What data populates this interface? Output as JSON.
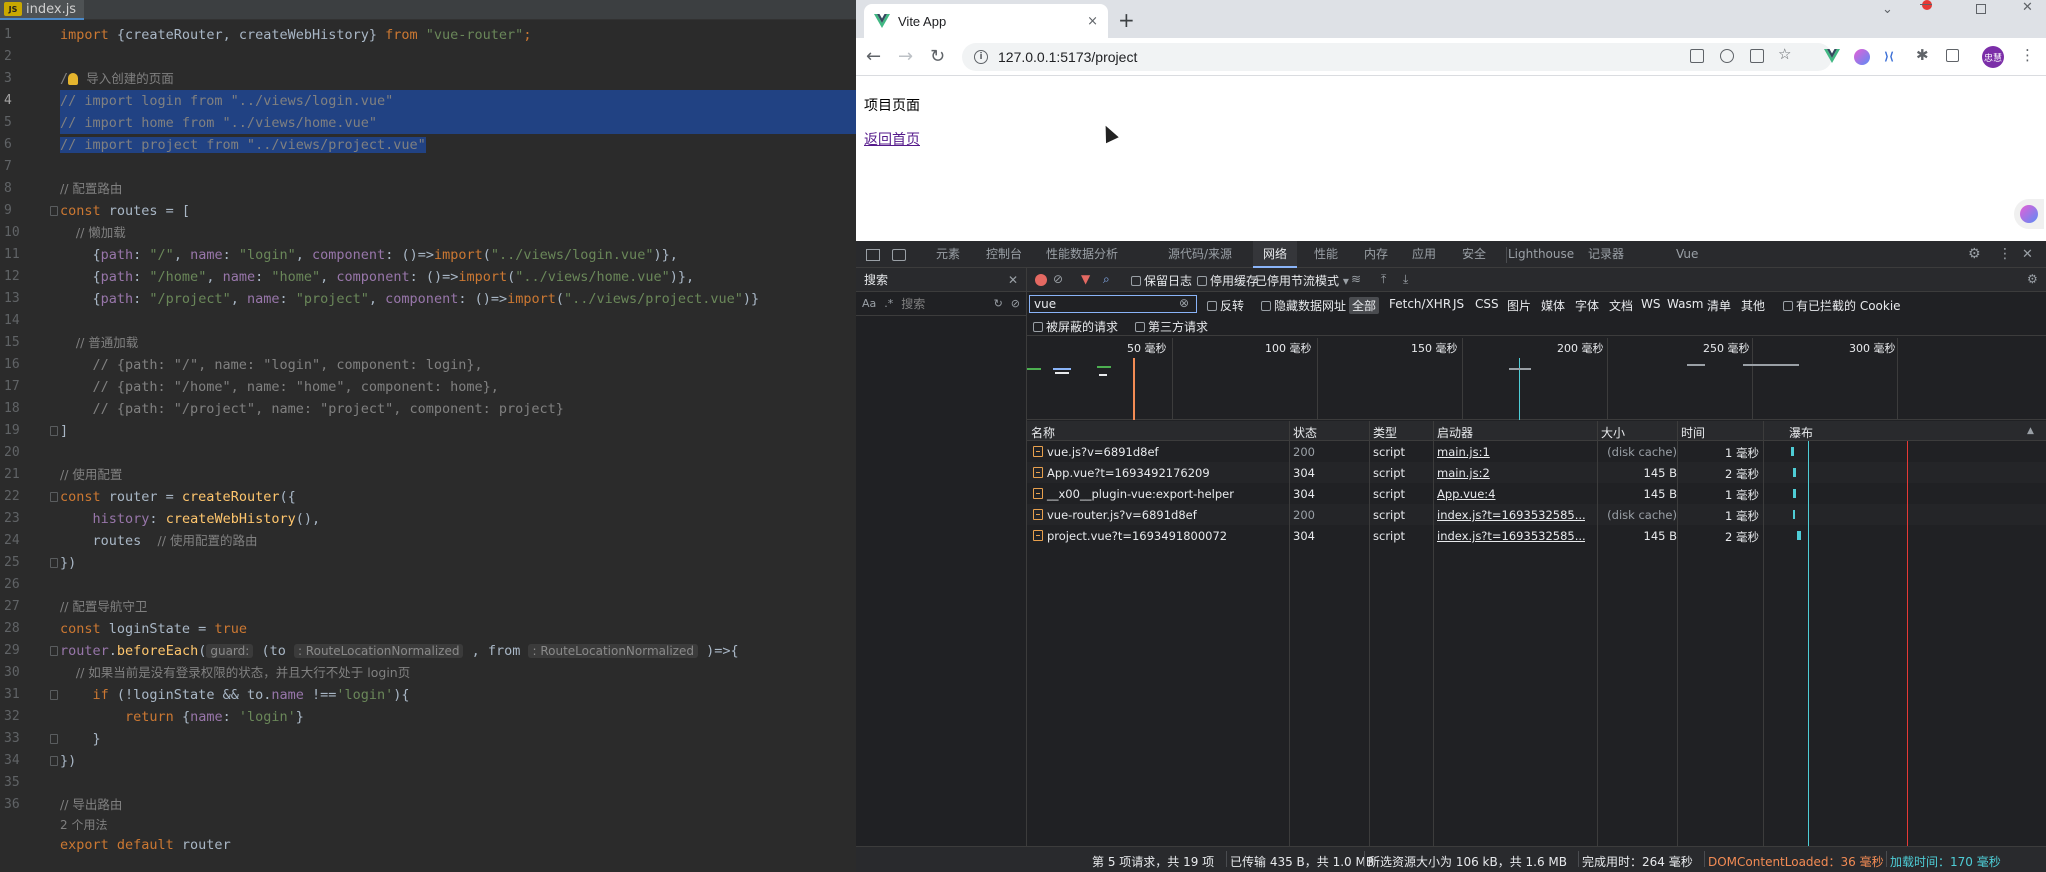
{
  "editor": {
    "file_tab": "index.js",
    "file_badge": "JS",
    "line_numbers": [
      "1",
      "2",
      "3",
      "4",
      "5",
      "6",
      "7",
      "8",
      "9",
      "10",
      "11",
      "12",
      "13",
      "14",
      "15",
      "16",
      "17",
      "18",
      "19",
      "20",
      "21",
      "22",
      "23",
      "24",
      "25",
      "26",
      "27",
      "28",
      "29",
      "30",
      "31",
      "32",
      "33",
      "34",
      "35",
      "36",
      ""
    ],
    "l1": {
      "a": "import",
      "b": " {createRouter, createWebHistory} ",
      "c": "from",
      "d": " \"vue-router\"",
      "e": ";"
    },
    "l3": {
      "a": "/",
      "b": "导入创建的页面"
    },
    "l4": "// import login from \"../views/login.vue\"",
    "l5": "// import home from \"../views/home.vue\"",
    "l6": "// import project from \"../views/project.vue\"",
    "l8": "// 配置路由",
    "l9": {
      "a": "const",
      "b": " routes = ["
    },
    "l10": "    // 懒加载",
    "l11": {
      "a": "    {",
      "b": "path",
      "c": ": ",
      "d": "\"/\"",
      "e": ", ",
      "f": "name",
      "g": ": ",
      "h": "\"login\"",
      "i": ", ",
      "j": "component",
      "k": ": ()=>",
      "l": "import",
      "m": "(",
      "n": "\"../views/login.vue\"",
      "o": ")},"
    },
    "l12": {
      "a": "    {",
      "b": "path",
      "c": ": ",
      "d": "\"/home\"",
      "e": ", ",
      "f": "name",
      "g": ": ",
      "h": "\"home\"",
      "i": ", ",
      "j": "component",
      "k": ": ()=>",
      "l": "import",
      "m": "(",
      "n": "\"../views/home.vue\"",
      "o": ")},"
    },
    "l13": {
      "a": "    {",
      "b": "path",
      "c": ": ",
      "d": "\"/project\"",
      "e": ", ",
      "f": "name",
      "g": ": ",
      "h": "\"project\"",
      "i": ", ",
      "j": "component",
      "k": ": ()=>",
      "l": "import",
      "m": "(",
      "n": "\"../views/project.vue\"",
      "o": ")}"
    },
    "l15": "    // 普通加载",
    "l16": "    // {path: \"/\", name: \"login\", component: login},",
    "l17": "    // {path: \"/home\", name: \"home\", component: home},",
    "l18": "    // {path: \"/project\", name: \"project\", component: project}",
    "l19": "]",
    "l21": "// 使用配置",
    "l22": {
      "a": "const",
      "b": " router = ",
      "c": "createRouter",
      "d": "({"
    },
    "l23": {
      "a": "    ",
      "b": "history",
      "c": ": ",
      "d": "createWebHistory",
      "e": "(),"
    },
    "l24": {
      "a": "    routes  ",
      "b": "// 使用配置的路由"
    },
    "l25": "})",
    "l27": "// 配置导航守卫",
    "l28": {
      "a": "const",
      "b": " loginState = ",
      "c": "true"
    },
    "l29": {
      "a": "router",
      "b": ".",
      "c": "beforeEach",
      "d": "(",
      "e": "guard:",
      "f": " (to ",
      "g": ": RouteLocationNormalized",
      "h": " , from ",
      "i": ": RouteLocationNormalized",
      "j": " )=>{"
    },
    "l30": "    // 如果当前是没有登录权限的状态，并且大行不处于 login页",
    "l31": {
      "a": "    ",
      "b": "if",
      "c": " (!loginState && to.",
      "d": "name",
      "e": " !==",
      "f": "'login'",
      "g": "){"
    },
    "l32": {
      "a": "        ",
      "b": "return",
      "c": " {",
      "d": "name",
      "e": ": ",
      "f": "'login'",
      "g": "}"
    },
    "l33": "    }",
    "l34": "})",
    "l36": "// 导出路由",
    "usages": "2 个用法",
    "l37": {
      "a": "export default",
      "b": " router"
    }
  },
  "browser": {
    "tab_title": "Vite App",
    "tab_close": "×",
    "new_tab": "+",
    "url": "127.0.0.1:5173/project",
    "avatar": "忠慧",
    "page_heading": "项目页面",
    "back_link": "返回首页"
  },
  "devtools": {
    "tabs": [
      "元素",
      "控制台",
      "性能数据分析",
      "源代码/来源",
      "网络",
      "性能",
      "内存",
      "应用",
      "安全",
      "Lighthouse",
      "记录器",
      "Vue"
    ],
    "active_tab": "网络",
    "search_label": "搜索",
    "search_aa": "Aa",
    "search_regex": ".*",
    "search_placeholder": "搜索",
    "toolbar": {
      "preserve_log": "保留日志",
      "disable_cache": "停用缓存",
      "throttle": "已停用节流模式"
    },
    "filter_value": "vue",
    "filters": {
      "invert": "反转",
      "hide_data_urls": "隐藏数据网址",
      "types": [
        "全部",
        "Fetch/XHR",
        "JS",
        "CSS",
        "图片",
        "媒体",
        "字体",
        "文档",
        "WS",
        "Wasm",
        "清单",
        "其他"
      ],
      "blocked_cookies": "有已拦截的 Cookie",
      "blocked_requests": "被屏蔽的请求",
      "third_party": "第三方请求"
    },
    "ticks": [
      "50 毫秒",
      "100 毫秒",
      "150 毫秒",
      "200 毫秒",
      "250 毫秒",
      "300 毫秒"
    ],
    "columns": {
      "name": "名称",
      "status": "状态",
      "type": "类型",
      "initiator": "启动器",
      "size": "大小",
      "time": "时间",
      "waterfall": "瀑布"
    },
    "rows": [
      {
        "name": "vue.js?v=6891d8ef",
        "status": "200",
        "type": "script",
        "initiator": "main.js:1",
        "size": "(disk cache)",
        "time": "1 毫秒"
      },
      {
        "name": "App.vue?t=1693492176209",
        "status": "304",
        "type": "script",
        "initiator": "main.js:2",
        "size": "145 B",
        "time": "2 毫秒"
      },
      {
        "name": "__x00__plugin-vue:export-helper",
        "status": "304",
        "type": "script",
        "initiator": "App.vue:4",
        "size": "145 B",
        "time": "1 毫秒"
      },
      {
        "name": "vue-router.js?v=6891d8ef",
        "status": "200",
        "type": "script",
        "initiator": "index.js?t=1693532585...",
        "size": "(disk cache)",
        "time": "1 毫秒"
      },
      {
        "name": "project.vue?t=1693491800072",
        "status": "304",
        "type": "script",
        "initiator": "index.js?t=1693532585...",
        "size": "145 B",
        "time": "2 毫秒"
      }
    ],
    "status": {
      "requests": "第 5 项请求，共 19 项",
      "transferred": "已传输 435 B，共 1.0 MB",
      "resources": "所选资源大小为 106 kB，共 1.6 MB",
      "finish": "完成用时：264 毫秒",
      "dcl": "DOMContentLoaded：36 毫秒",
      "load": "加载时间：170 毫秒"
    },
    "colors": {
      "dcl": "#f28b54",
      "load": "#4ecdd6",
      "accent": "#8ab4f8"
    }
  }
}
